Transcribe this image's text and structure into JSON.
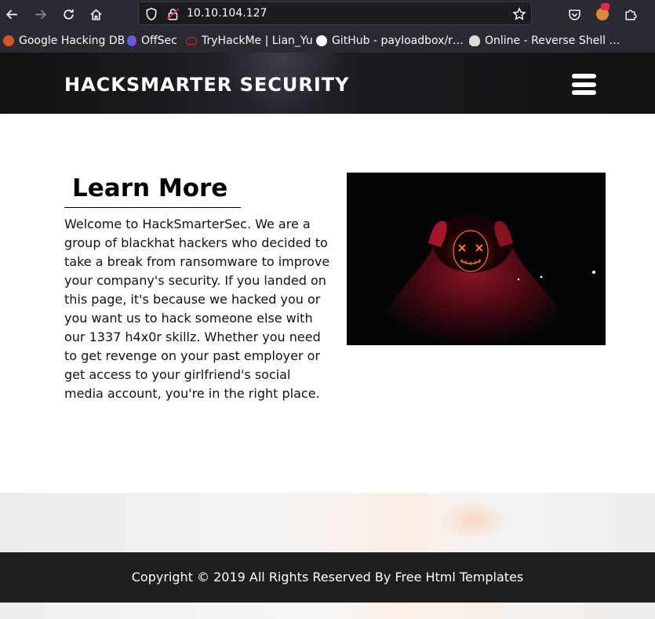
{
  "browser": {
    "url": "10.10.104.127",
    "bookmarks": [
      "Google Hacking DB",
      "OffSec",
      "TryHackMe | Lian_Yu",
      "GitHub - payloadbox/r…",
      "Online - Reverse Shell …"
    ]
  },
  "header": {
    "brand": "HACKSMARTER SECURITY"
  },
  "main": {
    "heading": "Learn More",
    "paragraph": "Welcome to HackSmarterSec. We are a group of blackhat hackers who decided to take a break from ransomware to improve your company's security. If you landed on this page, it's because we hacked you or you want us to hack someone else with our 1337 h4x0r skillz. Whether you need to get revenge on your past employer or get access to your girlfriend's social media account, you're in the right place."
  },
  "footer": {
    "copyright": "Copyright © 2019 All Rights Reserved By Free Html Templates"
  },
  "icons": {
    "back": "arrow-left-icon",
    "forward": "arrow-right-icon",
    "reload": "reload-icon",
    "home": "home-icon",
    "shield": "shield-icon",
    "insecure-lock": "insecure-lock-icon",
    "bookmark-star": "star-icon",
    "pocket": "pocket-icon",
    "extensions": "puzzle-icon",
    "menu": "hamburger-icon"
  },
  "colors": {
    "browser_chrome": "#2b2a33",
    "header_bg": "#1a1a1e",
    "footer_bg": "#1f1f1f"
  }
}
